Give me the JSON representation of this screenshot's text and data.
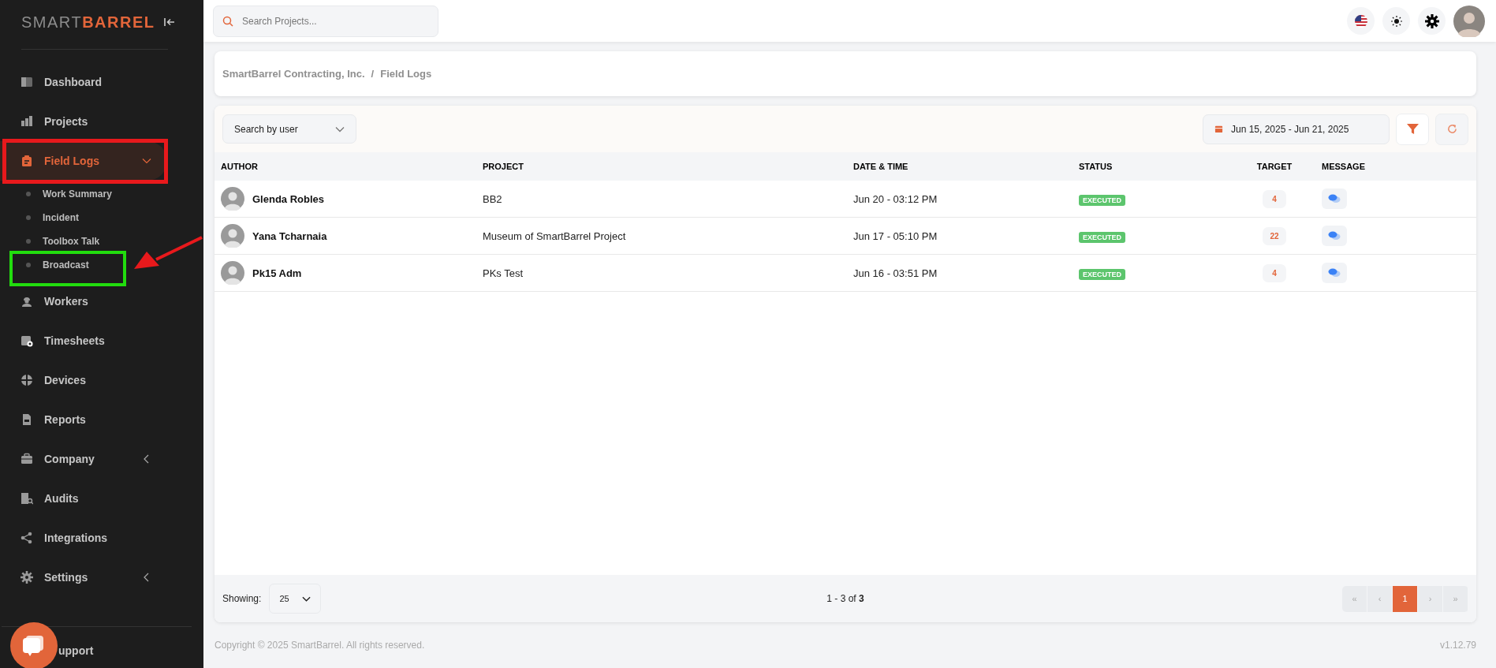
{
  "logo": {
    "light": "SMART",
    "bold": "BARREL"
  },
  "sidebar": {
    "items": [
      {
        "label": "Dashboard",
        "selected": false
      },
      {
        "label": "Projects",
        "selected": false
      },
      {
        "label": "Field Logs",
        "selected": true,
        "expanded": true,
        "color": "#e8191c",
        "children": [
          {
            "label": "Work Summary",
            "selected": false
          },
          {
            "label": "Incident",
            "selected": false
          },
          {
            "label": "Toolbox Talk",
            "selected": false
          },
          {
            "label": "Broadcast",
            "selected": false,
            "color": "#22dd0e",
            "pointer_arrow": true
          }
        ]
      },
      {
        "label": "Workers",
        "selected": false
      },
      {
        "label": "Timesheets",
        "selected": false
      },
      {
        "label": "Devices",
        "selected": false
      },
      {
        "label": "Reports",
        "selected": false
      },
      {
        "label": "Company",
        "selected": false,
        "expanded": false
      },
      {
        "label": "Audits",
        "selected": false
      },
      {
        "label": "Integrations",
        "selected": false
      },
      {
        "label": "Settings",
        "selected": false,
        "expanded": false
      }
    ],
    "support": "upport"
  },
  "search": {
    "placeholder": "Search Projects..."
  },
  "breadcrumb": {
    "items": [
      "SmartBarrel Contracting, Inc.",
      "Field Logs"
    ],
    "separator": "/"
  },
  "toolbar": {
    "user_filter": {
      "placeholder": "Search by user"
    },
    "date_range": "Jun 15, 2025 - Jun 21, 2025"
  },
  "table": {
    "columns": [
      "AUTHOR",
      "PROJECT",
      "DATE & TIME",
      "STATUS",
      "TARGET",
      "MESSAGE"
    ],
    "rows": [
      {
        "author": "Glenda Robles",
        "project": "BB2",
        "datetime": "Jun 20 - 03:12 PM",
        "status": "EXECUTED",
        "target": "4"
      },
      {
        "author": "Yana Tcharnaia",
        "project": "Museum of SmartBarrel Project",
        "datetime": "Jun 17 - 05:10 PM",
        "status": "EXECUTED",
        "target": "22"
      },
      {
        "author": "Pk15 Adm",
        "project": "PKs Test",
        "datetime": "Jun 16 - 03:51 PM",
        "status": "EXECUTED",
        "target": "4"
      }
    ]
  },
  "footer_bar": {
    "showing_label": "Showing:",
    "page_size": "25",
    "range": "1 - 3 of **3**",
    "pages": [
      {
        "label": "«",
        "selected": false
      },
      {
        "label": "‹",
        "selected": false
      },
      {
        "label": "1",
        "selected": true
      },
      {
        "label": "›",
        "selected": false
      },
      {
        "label": "»",
        "selected": false
      }
    ]
  },
  "copyright": "Copyright © 2025 SmartBarrel. All rights reserved.",
  "version": "v1.12.79"
}
